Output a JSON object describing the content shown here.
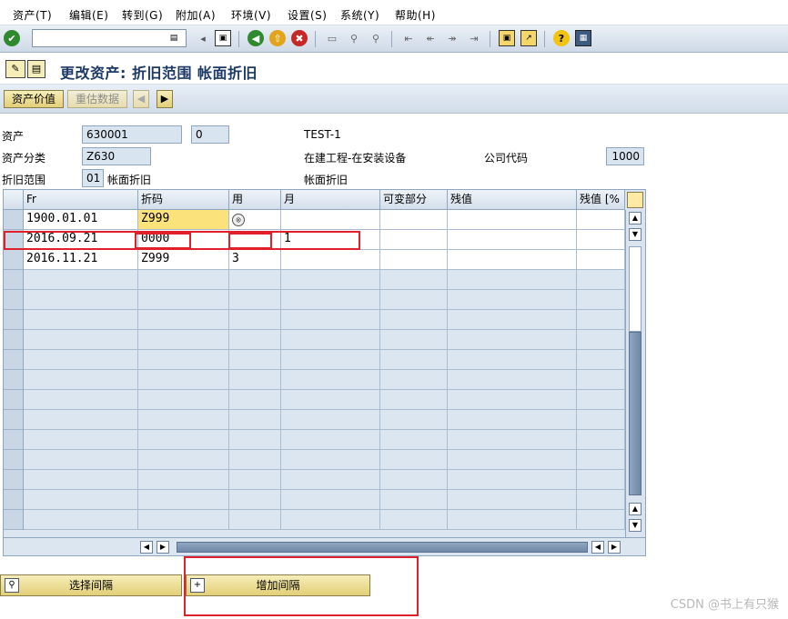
{
  "menu": [
    "资产(T)",
    "编辑(E)",
    "转到(G)",
    "附加(A)",
    "环境(V)",
    "设置(S)",
    "系统(Y)",
    "帮助(H)"
  ],
  "toolbar": {
    "command_value": "",
    "icons": [
      "enter-icon",
      "save-icon",
      "back-icon",
      "exit-icon",
      "cancel-icon",
      "print-icon",
      "find-icon",
      "find-next-icon",
      "first-page-icon",
      "previous-page-icon",
      "next-page-icon",
      "last-page-icon",
      "new-session-icon",
      "shortcut-icon",
      "help-icon",
      "layout-icon"
    ]
  },
  "title": "更改资产: 折旧范围 帐面折旧",
  "app_toolbar": {
    "asset_value_btn": "资产价值",
    "revaluation_btn": "重估数据"
  },
  "header": {
    "asset_label": "资产",
    "asset_main": "630001",
    "asset_sub": "0",
    "asset_desc": "TEST-1",
    "class_label": "资产分类",
    "class_value": "Z630",
    "class_desc": "在建工程-在安装设备",
    "company_label": "公司代码",
    "company_value": "1000",
    "area_label": "折旧范围",
    "area_value": "01",
    "area_name": "帐面折旧",
    "area_desc": "帐面折旧"
  },
  "table": {
    "columns": [
      "Fr",
      "折码",
      "用",
      "月",
      "可变部分",
      "残值",
      "残值 [%"
    ],
    "rows": [
      {
        "fr": "1900.01.01",
        "code": "Z999",
        "use": "",
        "month": "",
        "variable": "",
        "salvage": "",
        "salvage_pct": ""
      },
      {
        "fr": "2016.09.21",
        "code": "0000",
        "use": "",
        "month": "1",
        "variable": "",
        "salvage": "",
        "salvage_pct": ""
      },
      {
        "fr": "2016.11.21",
        "code": "Z999",
        "use": "3",
        "month": "",
        "variable": "",
        "salvage": "",
        "salvage_pct": ""
      }
    ]
  },
  "buttons": {
    "select_interval": "选择间隔",
    "add_interval": "增加间隔"
  },
  "colors": {
    "highlight_red": "#e0202a",
    "yellow_cell": "#fbe27a",
    "title_blue": "#1d3a66"
  },
  "watermark": "CSDN @书上有只猴"
}
